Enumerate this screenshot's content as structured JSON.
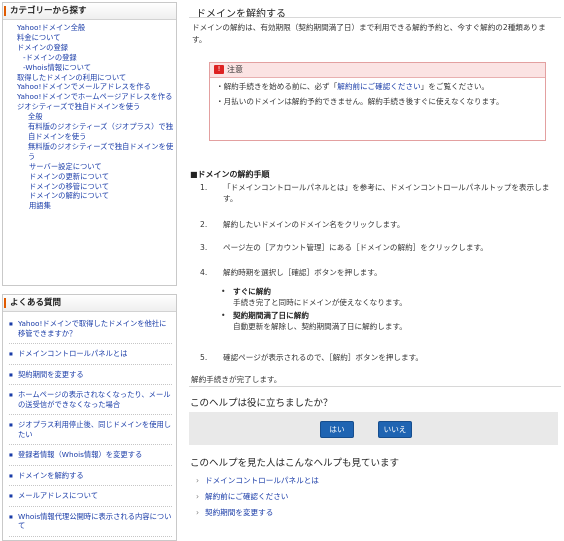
{
  "sidebar": {
    "category": {
      "title": "カテゴリーから探す",
      "items": [
        {
          "label": "Yahoo!ドメイン全般",
          "level": 1
        },
        {
          "label": "料金について",
          "level": 1
        },
        {
          "label": "ドメインの登録",
          "level": 1
        },
        {
          "label": "ドメインの登録",
          "level": 2
        },
        {
          "label": "Whois情報について",
          "level": 2
        },
        {
          "label": "取得したドメインの利用について",
          "level": 1
        },
        {
          "label": "Yahoo!ドメインでメールアドレスを作る",
          "level": 1
        },
        {
          "label": "Yahoo!ドメインでホームページアドレスを作る",
          "level": 1
        },
        {
          "label": "ジオシティーズで独自ドメインを使う",
          "level": 1
        },
        {
          "label": "全般",
          "level": 3
        },
        {
          "label": "有料版のジオシティーズ（ジオプラス）で独自ドメインを使う",
          "level": 3
        },
        {
          "label": "無料版のジオシティーズで独自ドメインを使う",
          "level": 3
        },
        {
          "label": "サーバー設定について",
          "level": 4
        },
        {
          "label": "ドメインの更新について",
          "level": 4
        },
        {
          "label": "ドメインの移管について",
          "level": 4
        },
        {
          "label": "ドメインの解約について",
          "level": 4
        },
        {
          "label": "用語集",
          "level": 4
        }
      ]
    },
    "faq": {
      "title": "よくある質問",
      "items": [
        "Yahoo!ドメインで取得したドメインを他社に移管できますか？",
        "ドメインコントロールパネルとは",
        "契約期間を変更する",
        "ホームページの表示されなくなったり、メールの送受信ができなくなった場合",
        "ジオプラス利用停止後、同じドメインを使用したい",
        "登録者情報（Whois情報）を変更する",
        "ドメインを解約する",
        "メールアドレスについて",
        "Whois情報代理公開時に表示される内容について"
      ]
    }
  },
  "main": {
    "title": "ドメインを解約する",
    "intro": "ドメインの解約は、有効期限（契約期間満了日）まで利用できる解約予約と、今すぐ解約の2種類あります。",
    "warning": {
      "label": "注意",
      "line1_pre": "・解約手続きを始める前に、必ず「",
      "line1_link": "解約前にご確認ください",
      "line1_post": "」をご覧ください。",
      "line2": "・月払いのドメインは解約予約できません。解約手続き後すぐに使えなくなります。"
    },
    "procedure_title": "■ドメインの解約手順",
    "steps": [
      {
        "num": "1.",
        "text": "「ドメインコントロールパネルとは」を参考に、ドメインコントロールパネルトップを表示します。"
      },
      {
        "num": "2.",
        "text": "解約したいドメインのドメイン名をクリックします。"
      },
      {
        "num": "3.",
        "text": "ページ左の［アカウント管理］にある［ドメインの解約］をクリックします。"
      },
      {
        "num": "4.",
        "text": "解約時期を選択し［確認］ボタンを押します。"
      },
      {
        "num": "5.",
        "text": "確認ページが表示されるので、［解約］ボタンを押します。"
      }
    ],
    "options": [
      {
        "label": "すぐに解約",
        "desc": "手続き完了と同時にドメインが使えなくなります。"
      },
      {
        "label": "契約期間満了日に解約",
        "desc": "自動更新を解除し、契約期間満了日に解約します。"
      }
    ],
    "done": "解約手続きが完了します。",
    "feedback": {
      "question": "このヘルプは役に立ちましたか？",
      "yes": "はい",
      "no": "いいえ"
    },
    "related": {
      "title": "このヘルプを見た人はこんなヘルプも見ています",
      "items": [
        "ドメインコントロールパネルとは",
        "解約前にご確認ください",
        "契約期間を変更する"
      ]
    }
  }
}
